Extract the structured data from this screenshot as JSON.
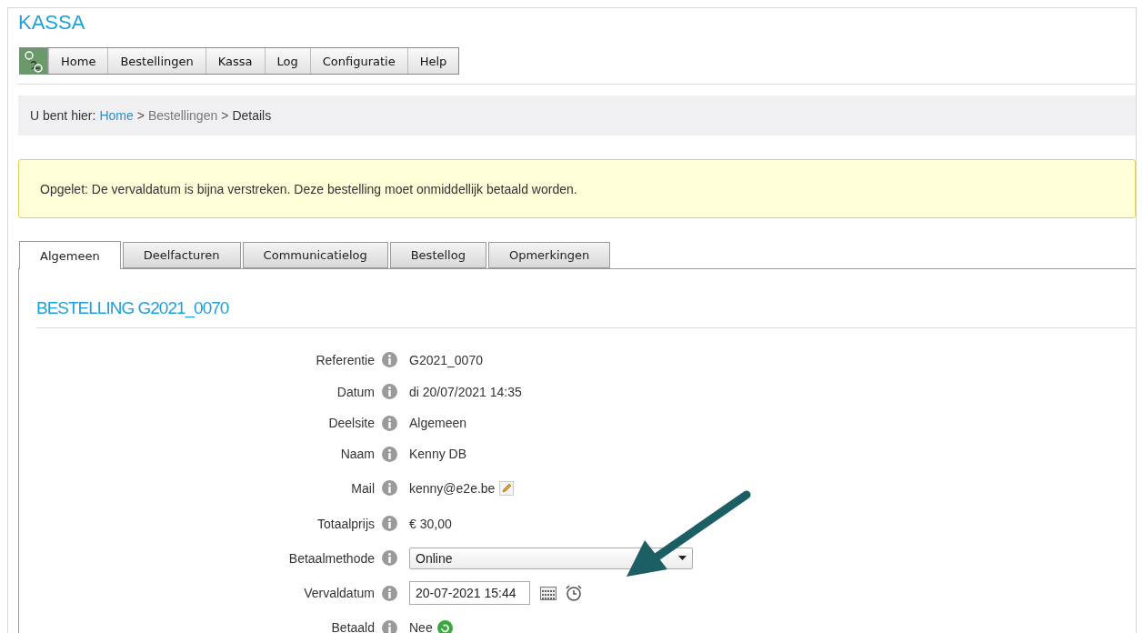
{
  "app_title": "KASSA",
  "nav": [
    {
      "label": "Home"
    },
    {
      "label": "Bestellingen"
    },
    {
      "label": "Kassa"
    },
    {
      "label": "Log"
    },
    {
      "label": "Configuratie"
    },
    {
      "label": "Help"
    }
  ],
  "breadcrumb": {
    "prefix": "U bent hier:",
    "items": [
      {
        "label": "Home",
        "kind": "link"
      },
      {
        "label": "Bestellingen",
        "kind": "muted"
      },
      {
        "label": "Details",
        "kind": "current"
      }
    ],
    "separator": ">"
  },
  "alert": "Opgelet: De vervaldatum is bijna verstreken. Deze bestelling moet onmiddellijk betaald worden.",
  "tabs": [
    {
      "label": "Algemeen",
      "selected": true
    },
    {
      "label": "Deelfacturen",
      "selected": false
    },
    {
      "label": "Communicatielog",
      "selected": false
    },
    {
      "label": "Bestellog",
      "selected": false
    },
    {
      "label": "Opmerkingen",
      "selected": false
    }
  ],
  "heading": "BESTELLING G2021_0070",
  "fields": [
    {
      "label": "Referentie",
      "kind": "text",
      "value": "G2021_0070"
    },
    {
      "label": "Datum",
      "kind": "text",
      "value": "di 20/07/2021 14:35"
    },
    {
      "label": "Deelsite",
      "kind": "text",
      "value": "Algemeen"
    },
    {
      "label": "Naam",
      "kind": "text",
      "value": "Kenny DB"
    },
    {
      "label": "Mail",
      "kind": "email",
      "value": "kenny@e2e.be"
    },
    {
      "label": "Totaalprijs",
      "kind": "text",
      "value": "€ 30,00"
    },
    {
      "label": "Betaalmethode",
      "kind": "select",
      "value": "Online"
    },
    {
      "label": "Vervaldatum",
      "kind": "datetime",
      "value": "20-07-2021 15:44"
    },
    {
      "label": "Betaald",
      "kind": "status",
      "value": "Nee"
    }
  ]
}
